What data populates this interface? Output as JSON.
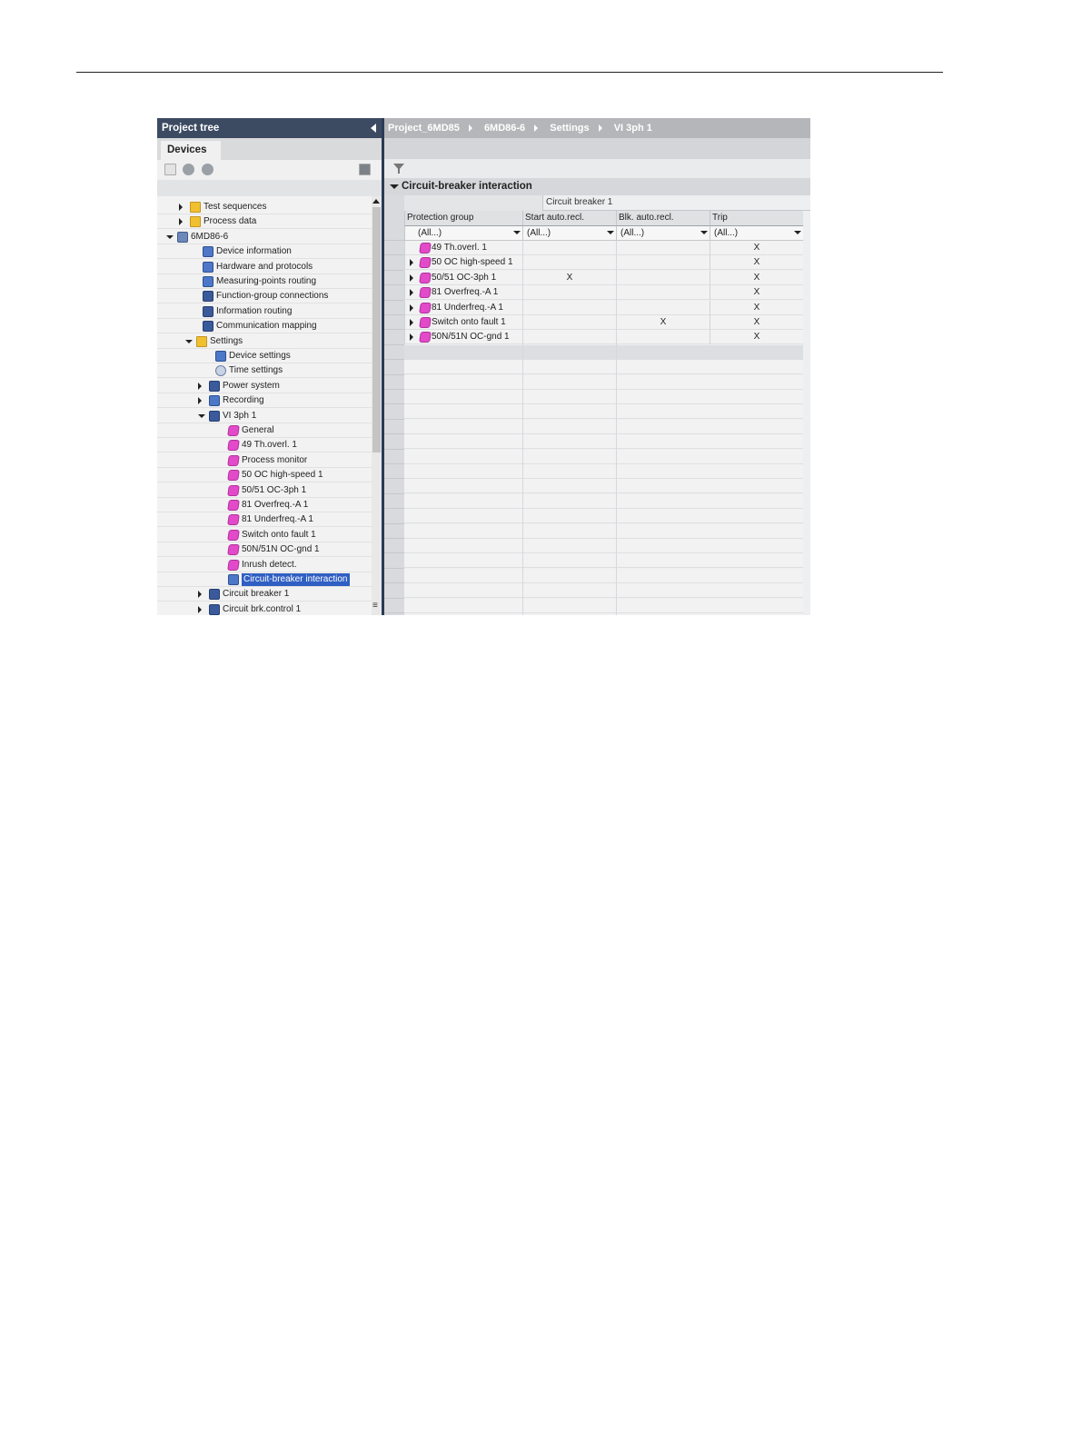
{
  "tree": {
    "title": "Project tree",
    "tab": "Devices",
    "items": [
      {
        "label": "Test sequences",
        "indent": 1,
        "expander": "right",
        "icon": "folder-icon"
      },
      {
        "label": "Process data",
        "indent": 1,
        "expander": "right",
        "icon": "folder-icon"
      },
      {
        "label": "6MD86-6",
        "indent": 0,
        "expander": "down",
        "icon": "device-icon"
      },
      {
        "label": "Device information",
        "indent": 2,
        "expander": "",
        "icon": "info-icon"
      },
      {
        "label": "Hardware and protocols",
        "indent": 2,
        "expander": "",
        "icon": "hardware-icon"
      },
      {
        "label": "Measuring-points routing",
        "indent": 2,
        "expander": "",
        "icon": "measuring-icon"
      },
      {
        "label": "Function-group connections",
        "indent": 2,
        "expander": "",
        "icon": "connection-icon"
      },
      {
        "label": "Information routing",
        "indent": 2,
        "expander": "",
        "icon": "routing-icon"
      },
      {
        "label": "Communication mapping",
        "indent": 2,
        "expander": "",
        "icon": "communication-icon"
      },
      {
        "label": "Settings",
        "indent": 1.5,
        "expander": "down",
        "icon": "folder-icon"
      },
      {
        "label": "Device settings",
        "indent": 3,
        "expander": "",
        "icon": "settings-icon"
      },
      {
        "label": "Time settings",
        "indent": 3,
        "expander": "",
        "icon": "clock-icon"
      },
      {
        "label": "Power system",
        "indent": 2.5,
        "expander": "right",
        "icon": "power-system-icon"
      },
      {
        "label": "Recording",
        "indent": 2.5,
        "expander": "right",
        "icon": "recording-icon"
      },
      {
        "label": "VI 3ph 1",
        "indent": 2.5,
        "expander": "down",
        "icon": "function-group-icon"
      },
      {
        "label": "General",
        "indent": 4,
        "expander": "",
        "icon": "function-block-icon"
      },
      {
        "label": "49 Th.overl. 1",
        "indent": 4,
        "expander": "",
        "icon": "function-block-icon"
      },
      {
        "label": "Process monitor",
        "indent": 4,
        "expander": "",
        "icon": "function-block-icon"
      },
      {
        "label": "50 OC high-speed 1",
        "indent": 4,
        "expander": "",
        "icon": "function-block-icon"
      },
      {
        "label": "50/51 OC-3ph 1",
        "indent": 4,
        "expander": "",
        "icon": "function-block-icon"
      },
      {
        "label": "81 Overfreq.-A 1",
        "indent": 4,
        "expander": "",
        "icon": "function-block-icon"
      },
      {
        "label": "81 Underfreq.-A 1",
        "indent": 4,
        "expander": "",
        "icon": "function-block-icon"
      },
      {
        "label": "Switch onto fault 1",
        "indent": 4,
        "expander": "",
        "icon": "function-block-icon"
      },
      {
        "label": "50N/51N OC-gnd 1",
        "indent": 4,
        "expander": "",
        "icon": "function-block-icon"
      },
      {
        "label": "Inrush detect.",
        "indent": 4,
        "expander": "",
        "icon": "function-block-icon"
      },
      {
        "label": "Circuit-breaker interaction",
        "indent": 4,
        "expander": "",
        "icon": "cb-interaction-icon",
        "selected": true
      },
      {
        "label": "Circuit breaker 1",
        "indent": 2.5,
        "expander": "right",
        "icon": "function-group-icon"
      },
      {
        "label": "Circuit brk.control 1",
        "indent": 2.5,
        "expander": "right",
        "icon": "function-group-icon"
      }
    ]
  },
  "breadcrumb": [
    "Project_6MD85",
    "6MD86-6",
    "Settings",
    "VI 3ph 1"
  ],
  "editor": {
    "section_title": "Circuit-breaker interaction",
    "group_header": "Circuit breaker 1",
    "columns": [
      "Protection group",
      "Start auto.recl.",
      "Blk. auto.recl.",
      "Trip"
    ],
    "filters": [
      "(All...)",
      "(All...)",
      "(All...)",
      "(All...)"
    ],
    "rows": [
      {
        "name": "49 Th.overl. 1",
        "expander": false,
        "start": "",
        "blk": "",
        "trip": "X"
      },
      {
        "name": "50 OC high-speed 1",
        "expander": true,
        "start": "",
        "blk": "",
        "trip": "X"
      },
      {
        "name": "50/51 OC-3ph 1",
        "expander": true,
        "start": "X",
        "blk": "",
        "trip": "X"
      },
      {
        "name": "81 Overfreq.-A 1",
        "expander": true,
        "start": "",
        "blk": "",
        "trip": "X"
      },
      {
        "name": "81 Underfreq.-A 1",
        "expander": true,
        "start": "",
        "blk": "",
        "trip": "X"
      },
      {
        "name": "Switch onto fault 1",
        "expander": true,
        "start": "",
        "blk": "X",
        "trip": "X"
      },
      {
        "name": "50N/51N OC-gnd 1",
        "expander": true,
        "start": "",
        "blk": "",
        "trip": "X"
      }
    ]
  },
  "colors": {
    "tree_header": "#3c4a62",
    "selection": "#2f5fc3",
    "function_icon": "#e24ac9",
    "breadcrumb_bg": "#b5b6b9"
  }
}
